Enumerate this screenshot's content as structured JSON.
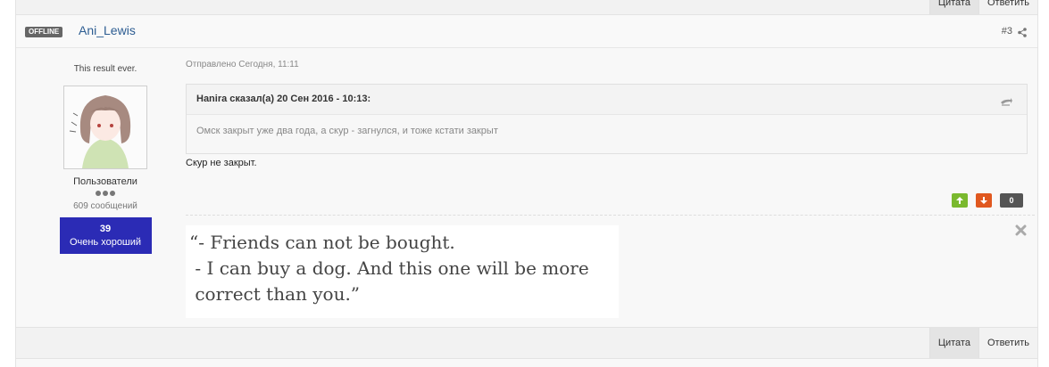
{
  "top_actions": {
    "quote": "Цитата",
    "reply": "Ответить"
  },
  "post": {
    "status_badge": "OFFLINE",
    "username": "Ani_Lewis",
    "post_number": "#3",
    "posted": "Отправлено Сегодня, 11:11",
    "author": {
      "title": "This result ever.",
      "group": "Пользователи",
      "post_count": "609 сообщений",
      "reputation_value": "39",
      "reputation_label": "Очень хороший"
    },
    "quote": {
      "header": "Hanira сказал(а) 20 Сен 2016 - 10:13:",
      "body": "Омск закрыт уже два года, а скур - загнулся, и тоже кстати закрыт"
    },
    "text": "Скур не закрыт.",
    "vote_count": "0",
    "signature": "“- Friends can not be bought.\n - I can buy a dog. And this one will be more\n correct than you.”"
  },
  "bottom_actions": {
    "quote": "Цитата",
    "reply": "Ответить"
  },
  "colors": {
    "username": "#2d5d92",
    "reputation_bg": "#2b2bb5",
    "vote_up": "#7ab92e",
    "vote_down": "#e0581f"
  }
}
